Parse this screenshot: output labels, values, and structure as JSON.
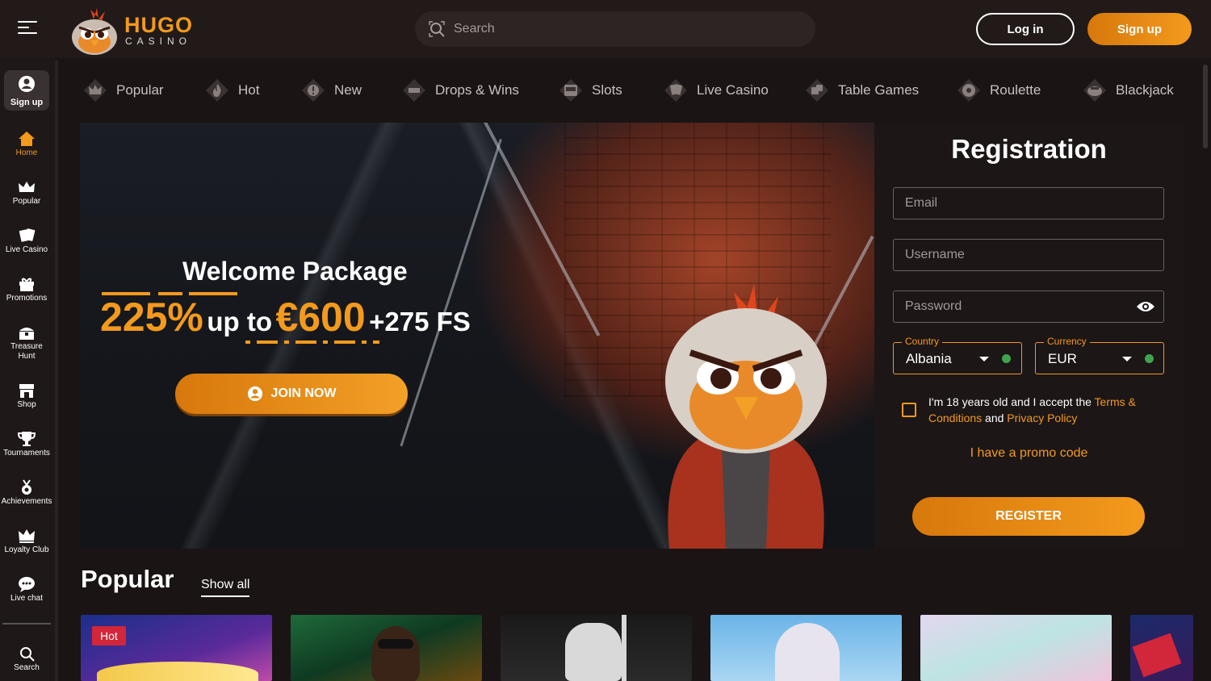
{
  "header": {
    "brand": "HUGO",
    "brand_sub": "CASINO",
    "search_placeholder": "Search",
    "login_label": "Log in",
    "signup_label": "Sign up"
  },
  "sidebar": {
    "signup_label": "Sign up",
    "items": [
      {
        "label": "Home",
        "icon": "home-icon",
        "active": true
      },
      {
        "label": "Popular",
        "icon": "crown-icon"
      },
      {
        "label": "Live Casino",
        "icon": "cards-icon"
      },
      {
        "label": "Promotions",
        "icon": "gift-icon"
      },
      {
        "label": "Treasure",
        "label2": "Hunt",
        "icon": "treasure-chest-icon"
      },
      {
        "label": "Shop",
        "icon": "shop-icon"
      },
      {
        "label": "Tournaments",
        "icon": "trophy-icon"
      },
      {
        "label": "Achievements",
        "icon": "medal-icon"
      },
      {
        "label": "Loyalty Club",
        "icon": "crown-icon"
      },
      {
        "label": "Live chat",
        "icon": "chat-icon"
      }
    ],
    "search_label": "Search"
  },
  "categories": [
    {
      "label": "Popular",
      "icon": "crown-icon"
    },
    {
      "label": "Hot",
      "icon": "flame-icon"
    },
    {
      "label": "New",
      "icon": "new-badge-icon"
    },
    {
      "label": "Drops & Wins",
      "icon": "drops-wins-icon"
    },
    {
      "label": "Slots",
      "icon": "slot-machine-icon"
    },
    {
      "label": "Live Casino",
      "icon": "cards-icon"
    },
    {
      "label": "Table Games",
      "icon": "dice-icon"
    },
    {
      "label": "Roulette",
      "icon": "roulette-icon"
    },
    {
      "label": "Blackjack",
      "icon": "blackjack-icon"
    }
  ],
  "hero": {
    "title": "Welcome Package",
    "percent": "225%",
    "up_to": "up to",
    "amount": "€600",
    "free_spins": "+275 FS",
    "join_label": "JOIN NOW"
  },
  "registration": {
    "title": "Registration",
    "email_placeholder": "Email",
    "username_placeholder": "Username",
    "password_placeholder": "Password",
    "country_legend": "Country",
    "country_value": "Albania",
    "currency_legend": "Currency",
    "currency_value": "EUR",
    "terms_prefix": "I'm 18 years old and I accept the ",
    "terms_link": "Terms & Conditions",
    "terms_and": " and ",
    "privacy_link": "Privacy Policy",
    "promo_label": "I have a promo code",
    "register_label": "REGISTER"
  },
  "popular": {
    "title": "Popular",
    "show_all": "Show all",
    "hot_badge": "Hot"
  },
  "colors": {
    "accent": "#f39a1c",
    "background": "#1a1414",
    "hot": "#d2263a"
  }
}
